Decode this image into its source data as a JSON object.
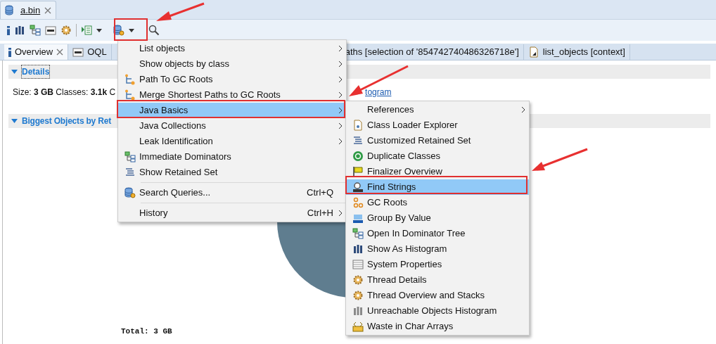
{
  "editor_tab": {
    "label": "a.bin",
    "selected": true
  },
  "view_tabs": [
    {
      "label": "Overview",
      "selected": true,
      "closable": true
    },
    {
      "label": "OQL",
      "selected": false,
      "closable": false
    },
    {
      "label": "aths [selection of '854742740486326718e']",
      "selected": false,
      "closable": false
    },
    {
      "label": "list_objects [context]",
      "selected": false,
      "closable": false
    }
  ],
  "details": {
    "title": "Details",
    "expanded": true,
    "summary": "Size: **3 GB** Classes: **3.1k** C",
    "link": "togram"
  },
  "biggest": {
    "title": "Biggest Objects by Ret",
    "expanded": true,
    "total": "Total: 3 GB"
  },
  "menu": {
    "items": [
      {
        "label": "List objects",
        "submenu": true,
        "selected": false,
        "separator_before": false
      },
      {
        "label": "Show objects by class",
        "submenu": true,
        "selected": false,
        "separator_before": false
      },
      {
        "label": "Path To GC Roots",
        "submenu": true,
        "selected": false,
        "separator_before": false
      },
      {
        "label": "Merge Shortest Paths to GC Roots",
        "submenu": true,
        "selected": false,
        "separator_before": false
      },
      {
        "label": "Java Basics",
        "submenu": true,
        "selected": true,
        "separator_before": false
      },
      {
        "label": "Java Collections",
        "submenu": true,
        "selected": false,
        "separator_before": false
      },
      {
        "label": "Leak Identification",
        "submenu": true,
        "selected": false,
        "separator_before": false
      },
      {
        "label": "Immediate Dominators",
        "submenu": false,
        "selected": false,
        "separator_before": false
      },
      {
        "label": "Show Retained Set",
        "submenu": false,
        "selected": false,
        "separator_before": false
      },
      {
        "label": "Search Queries...",
        "shortcut": "Ctrl+Q",
        "submenu": false,
        "selected": false,
        "separator_before": true
      },
      {
        "label": "History",
        "shortcut": "Ctrl+H",
        "submenu": true,
        "selected": false,
        "separator_before": true
      }
    ]
  },
  "submenu": {
    "items": [
      {
        "label": "References",
        "submenu": true,
        "selected": false
      },
      {
        "label": "Class Loader Explorer",
        "submenu": false,
        "selected": false
      },
      {
        "label": "Customized Retained Set",
        "submenu": false,
        "selected": false
      },
      {
        "label": "Duplicate Classes",
        "submenu": false,
        "selected": false
      },
      {
        "label": "Finalizer Overview",
        "submenu": false,
        "selected": false
      },
      {
        "label": "Find Strings",
        "submenu": false,
        "selected": true
      },
      {
        "label": "GC Roots",
        "submenu": false,
        "selected": false
      },
      {
        "label": "Group By Value",
        "submenu": false,
        "selected": false
      },
      {
        "label": "Open In Dominator Tree",
        "submenu": false,
        "selected": false
      },
      {
        "label": "Show As Histogram",
        "submenu": false,
        "selected": false
      },
      {
        "label": "System Properties",
        "submenu": false,
        "selected": false
      },
      {
        "label": "Thread Details",
        "submenu": false,
        "selected": false
      },
      {
        "label": "Thread Overview and Stacks",
        "submenu": false,
        "selected": false
      },
      {
        "label": "Unreachable Objects Histogram",
        "submenu": false,
        "selected": false
      },
      {
        "label": "Waste in Char Arrays",
        "submenu": false,
        "selected": false
      }
    ]
  }
}
